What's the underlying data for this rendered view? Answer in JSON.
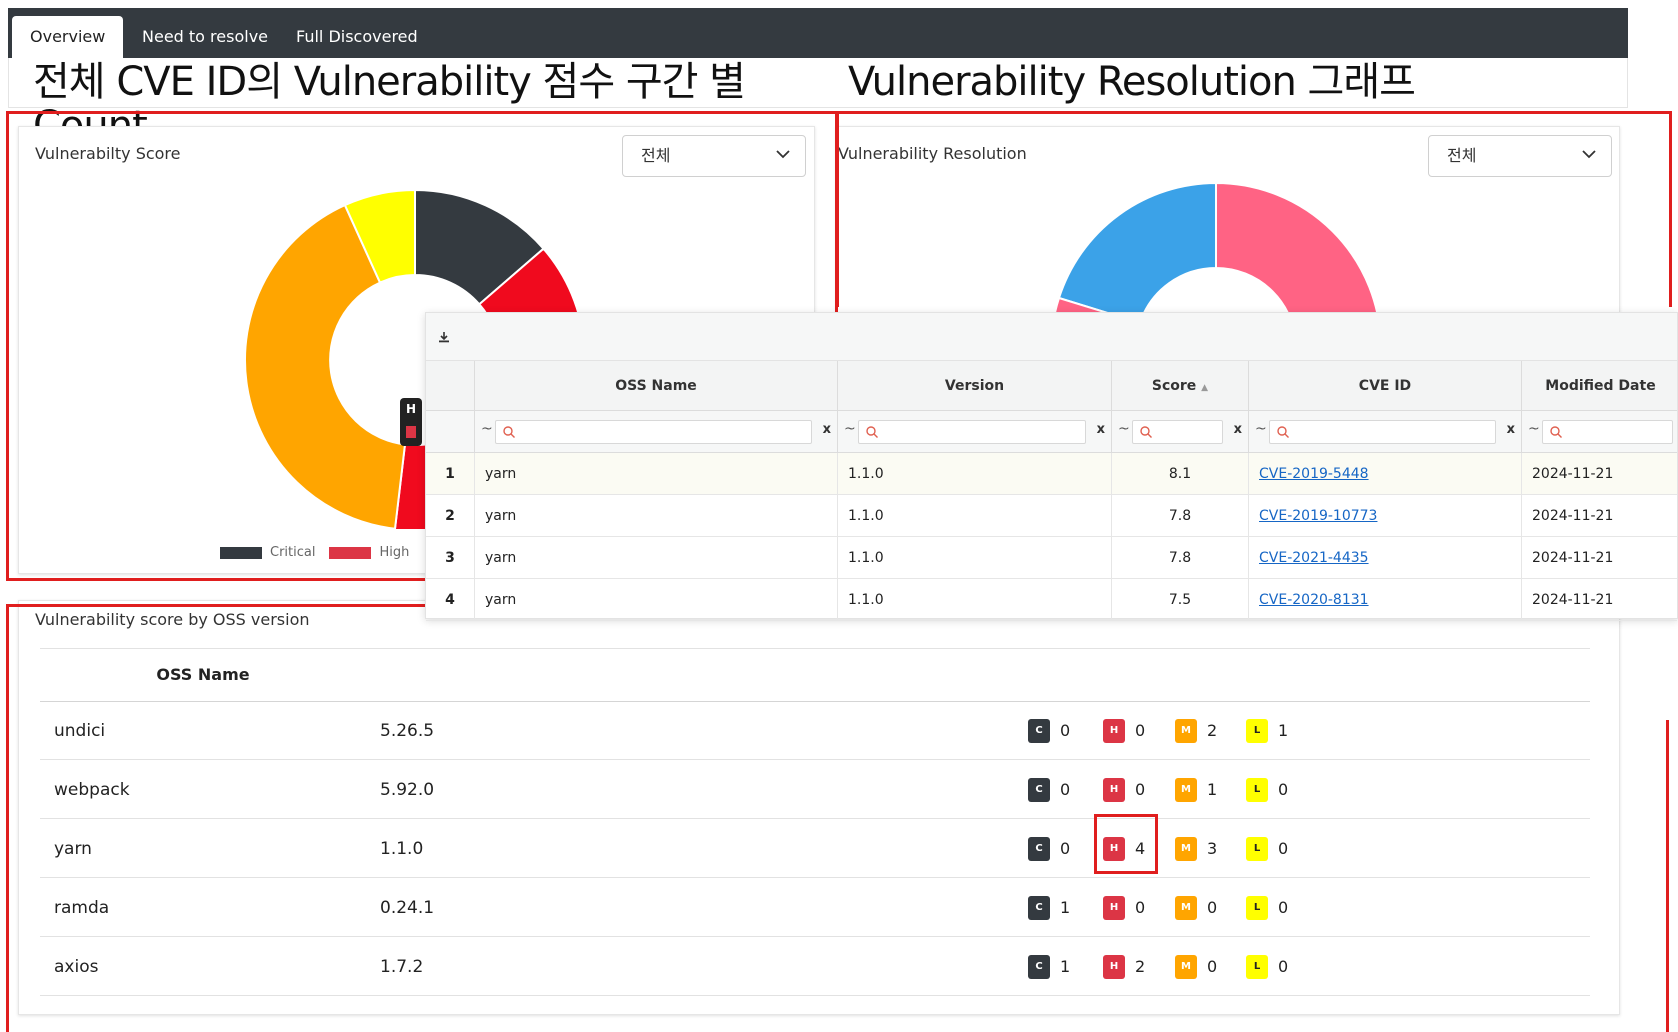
{
  "tabs": [
    {
      "label": "Overview",
      "active": true
    },
    {
      "label": "Need to resolve",
      "active": false
    },
    {
      "label": "Full Discovered",
      "active": false
    }
  ],
  "annotations": {
    "left_title_line1": "전체 CVE ID의 Vulnerability 점수 구간 별",
    "left_title_line2": "Count",
    "right_title": "Vulnerability Resolution 그래프"
  },
  "score_card": {
    "title": "Vulnerabilty Score",
    "select_value": "전체",
    "donut_label_peek": "H",
    "legend": [
      {
        "label": "Critical",
        "color": "#343a40"
      },
      {
        "label": "High",
        "color": "#dc3545"
      }
    ],
    "colors": {
      "critical": "#343a40",
      "high": "#f00a1e",
      "medium": "#ffa500",
      "low": "#ffff00"
    }
  },
  "resolution_card": {
    "title": "Vulnerability Resolution",
    "select_value": "전체",
    "colors": {
      "resolved": "#3ba2e8",
      "unresolved": "#ff6384"
    }
  },
  "grid": {
    "columns": [
      "",
      "OSS Name",
      "Version",
      "Score",
      "CVE ID",
      "Modified Date"
    ],
    "filter_tilde": "~",
    "filter_clear": "x",
    "rows": [
      {
        "no": "1",
        "oss": "yarn",
        "version": "1.1.0",
        "score": "8.1",
        "cve": "CVE-2019-5448",
        "date": "2024-11-21"
      },
      {
        "no": "2",
        "oss": "yarn",
        "version": "1.1.0",
        "score": "7.8",
        "cve": "CVE-2019-10773",
        "date": "2024-11-21"
      },
      {
        "no": "3",
        "oss": "yarn",
        "version": "1.1.0",
        "score": "7.8",
        "cve": "CVE-2021-4435",
        "date": "2024-11-21"
      },
      {
        "no": "4",
        "oss": "yarn",
        "version": "1.1.0",
        "score": "7.5",
        "cve": "CVE-2020-8131",
        "date": "2024-11-21"
      }
    ]
  },
  "oss_table": {
    "title": "Vulnerability score by OSS version",
    "header": "OSS Name",
    "badge_letters": {
      "c": "C",
      "h": "H",
      "m": "M",
      "l": "L"
    },
    "badge_colors": {
      "c": "#343a40",
      "h": "#dc3545",
      "m": "#ffa500",
      "l": "#ffff00"
    },
    "rows": [
      {
        "name": "undici",
        "version": "5.26.5",
        "c": "0",
        "h": "0",
        "m": "2",
        "l": "1"
      },
      {
        "name": "webpack",
        "version": "5.92.0",
        "c": "0",
        "h": "0",
        "m": "1",
        "l": "0"
      },
      {
        "name": "yarn",
        "version": "1.1.0",
        "c": "0",
        "h": "4",
        "m": "3",
        "l": "0"
      },
      {
        "name": "ramda",
        "version": "0.24.1",
        "c": "1",
        "h": "0",
        "m": "0",
        "l": "0"
      },
      {
        "name": "axios",
        "version": "1.7.2",
        "c": "1",
        "h": "2",
        "m": "0",
        "l": "0"
      }
    ]
  }
}
